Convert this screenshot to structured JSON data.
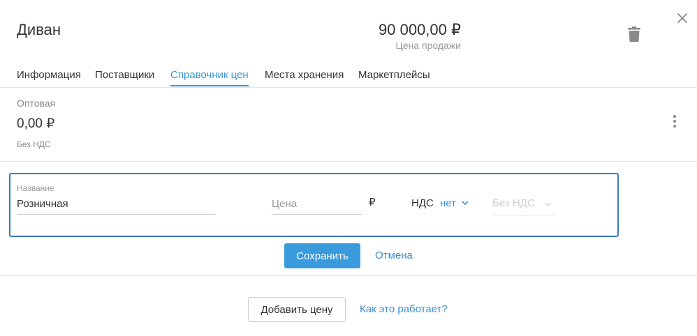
{
  "product": {
    "title": "Диван",
    "sale_price": "90 000,00 ₽",
    "sale_price_label": "Цена продажи"
  },
  "tabs": [
    {
      "label": "Информация",
      "active": false
    },
    {
      "label": "Поставщики",
      "active": false
    },
    {
      "label": "Справочник цен",
      "active": true
    },
    {
      "label": "Места хранения",
      "active": false
    },
    {
      "label": "Маркетплейсы",
      "active": false
    }
  ],
  "existing_price": {
    "type": "Оптовая",
    "value": "0,00 ₽",
    "vat": "Без НДС"
  },
  "form": {
    "name_label": "Название",
    "name_value": "Розничная",
    "price_placeholder": "Цена",
    "currency": "₽",
    "vat_label": "НДС",
    "vat_value": "нет",
    "vat_type_value": "Без НДС",
    "save_label": "Сохранить",
    "cancel_label": "Отмена"
  },
  "footer": {
    "add_price_label": "Добавить цену",
    "help_link": "Как это работает?"
  },
  "icons": {
    "close": "close-icon",
    "trash": "trash-icon",
    "more": "more-vertical-icon",
    "chevron": "chevron-down-icon"
  },
  "colors": {
    "accent": "#3a96d4",
    "primary_button": "#3a9bdc",
    "form_border": "#3a7bbd"
  }
}
